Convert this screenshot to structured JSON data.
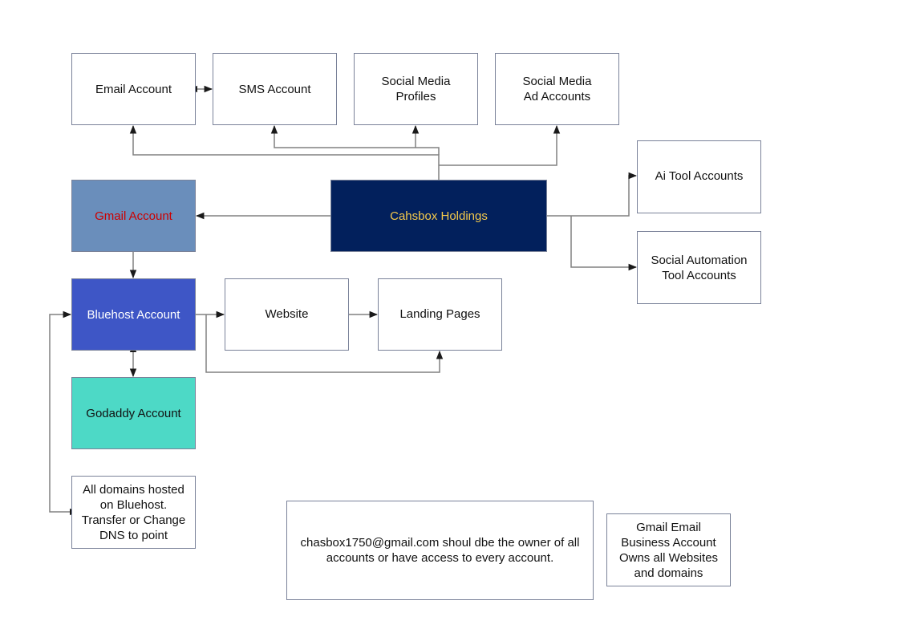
{
  "diagram": {
    "colors": {
      "edge": "#808080",
      "arrowhead": "#1a1a1a",
      "border": "#7a8299",
      "gmail_fill": "#6a8ebb",
      "gmail_text": "#cc0000",
      "cashbox_fill": "#02205c",
      "cashbox_text": "#f4c94b",
      "bluehost_fill": "#3e56c6",
      "bluehost_text": "#ffffff",
      "godaddy_fill": "#4dd9c6",
      "godaddy_text": "#111111"
    },
    "nodes": {
      "email": {
        "label": "Email Account"
      },
      "sms": {
        "label": "SMS Account"
      },
      "social_profiles": {
        "label": "Social Media\nProfiles"
      },
      "social_ads": {
        "label": "Social Media\nAd Accounts"
      },
      "ai_tools": {
        "label": "Ai Tool Accounts"
      },
      "gmail": {
        "label": "Gmail Account"
      },
      "cashbox": {
        "label": "Cahsbox Holdings"
      },
      "social_automation": {
        "label": "Social Automation\nTool Accounts"
      },
      "bluehost": {
        "label": "Bluehost Account"
      },
      "website": {
        "label": "Website"
      },
      "landing_pages": {
        "label": "Landing Pages"
      },
      "godaddy": {
        "label": "Godaddy Account"
      },
      "domains_note": {
        "label": "All domains hosted\non Bluehost.\nTransfer or Change\nDNS to point"
      },
      "owner_note": {
        "label": "chasbox1750@gmail.com shoul dbe the owner of all\naccounts or have access to every account."
      },
      "gmail_business_note": {
        "label": "Gmail Email\nBusiness Account\nOwns all Websites\nand domains"
      }
    },
    "edges": [
      {
        "from": "cashbox",
        "to": "email",
        "direction": "forward"
      },
      {
        "from": "cashbox",
        "to": "sms",
        "direction": "forward"
      },
      {
        "from": "cashbox",
        "to": "social_profiles",
        "direction": "forward"
      },
      {
        "from": "cashbox",
        "to": "social_ads",
        "direction": "forward"
      },
      {
        "from": "email",
        "to": "sms",
        "direction": "both"
      },
      {
        "from": "cashbox",
        "to": "gmail",
        "direction": "forward"
      },
      {
        "from": "cashbox",
        "to": "ai_tools",
        "direction": "forward"
      },
      {
        "from": "cashbox",
        "to": "social_automation",
        "direction": "forward"
      },
      {
        "from": "gmail",
        "to": "bluehost",
        "direction": "forward"
      },
      {
        "from": "bluehost",
        "to": "website",
        "direction": "forward"
      },
      {
        "from": "website",
        "to": "landing_pages",
        "direction": "forward"
      },
      {
        "from": "bluehost",
        "to": "landing_pages",
        "direction": "forward"
      },
      {
        "from": "bluehost",
        "to": "godaddy",
        "direction": "both"
      },
      {
        "from": "domains_note",
        "to": "bluehost",
        "direction": "both"
      }
    ]
  }
}
